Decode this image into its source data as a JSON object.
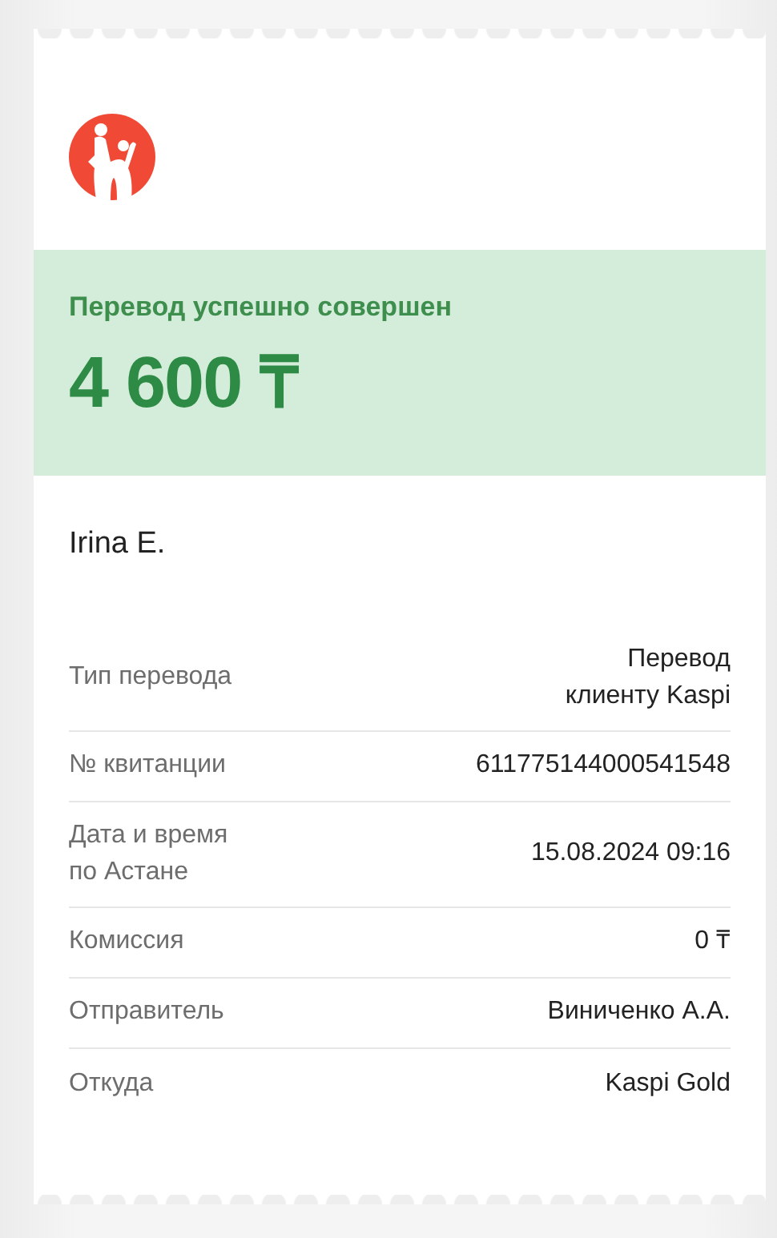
{
  "status": {
    "title": "Перевод успешно совершен",
    "amount": "4 600 ₸"
  },
  "recipient": "Irina E.",
  "details": [
    {
      "label": "Тип перевода",
      "value": "Перевод\nклиенту Kaspi"
    },
    {
      "label": "№ квитанции",
      "value": "611775144000541548"
    },
    {
      "label": "Дата и время\nпо Астане",
      "value": "15.08.2024 09:16"
    },
    {
      "label": "Комиссия",
      "value": "0 ₸"
    },
    {
      "label": "Отправитель",
      "value": "Виниченко А.А."
    },
    {
      "label": "Откуда",
      "value": "Kaspi Gold"
    }
  ]
}
